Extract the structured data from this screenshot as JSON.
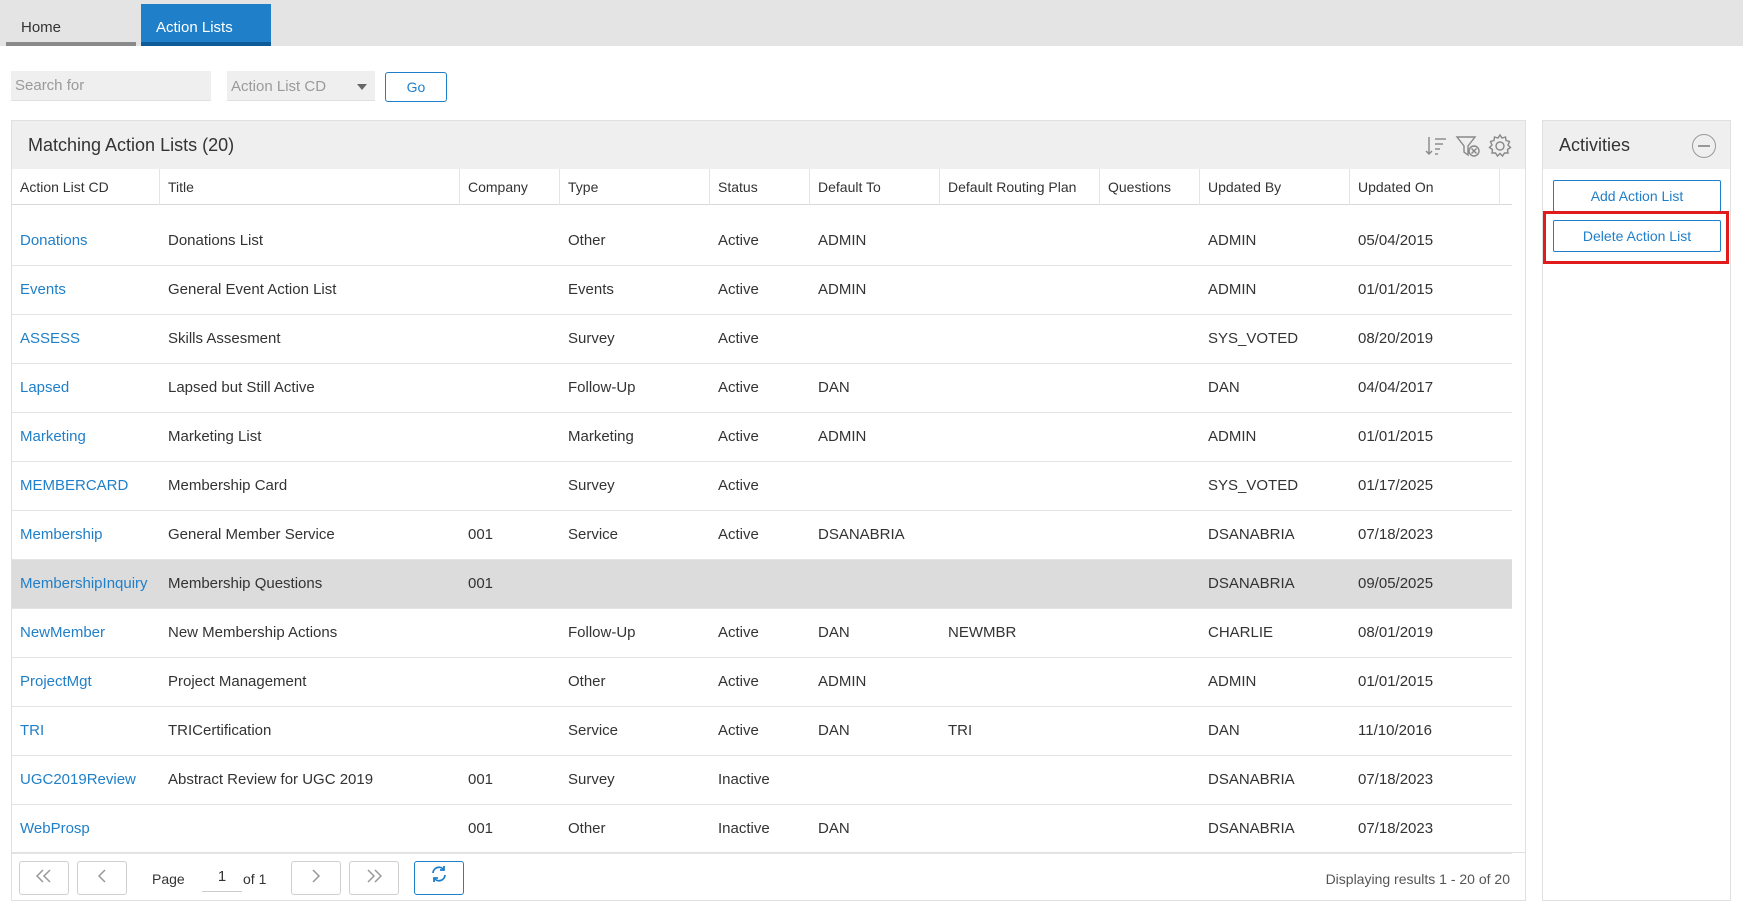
{
  "tabs": [
    {
      "label": "Home"
    },
    {
      "label": "Action Lists"
    }
  ],
  "search": {
    "placeholder": "Search for",
    "field_select": "Action List CD",
    "go_label": "Go"
  },
  "panel": {
    "title": "Matching Action Lists (20)"
  },
  "columns": [
    "Action List CD",
    "Title",
    "Company",
    "Type",
    "Status",
    "Default To",
    "Default Routing Plan",
    "Questions",
    "Updated By",
    "Updated On"
  ],
  "rows": [
    {
      "cd": "Donations",
      "title": "Donations List",
      "company": "",
      "type": "Other",
      "status": "Active",
      "default_to": "ADMIN",
      "routing": "",
      "questions": "",
      "updated_by": "ADMIN",
      "updated_on": "05/04/2015"
    },
    {
      "cd": "Events",
      "title": "General Event Action List",
      "company": "",
      "type": "Events",
      "status": "Active",
      "default_to": "ADMIN",
      "routing": "",
      "questions": "",
      "updated_by": "ADMIN",
      "updated_on": "01/01/2015"
    },
    {
      "cd": "ASSESS",
      "title": "Skills Assesment",
      "company": "",
      "type": "Survey",
      "status": "Active",
      "default_to": "",
      "routing": "",
      "questions": "",
      "updated_by": "SYS_VOTED",
      "updated_on": "08/20/2019"
    },
    {
      "cd": "Lapsed",
      "title": "Lapsed but Still Active",
      "company": "",
      "type": "Follow-Up",
      "status": "Active",
      "default_to": "DAN",
      "routing": "",
      "questions": "",
      "updated_by": "DAN",
      "updated_on": "04/04/2017"
    },
    {
      "cd": "Marketing",
      "title": "Marketing List",
      "company": "",
      "type": "Marketing",
      "status": "Active",
      "default_to": "ADMIN",
      "routing": "",
      "questions": "",
      "updated_by": "ADMIN",
      "updated_on": "01/01/2015"
    },
    {
      "cd": "MEMBERCARD",
      "title": "Membership Card",
      "company": "",
      "type": "Survey",
      "status": "Active",
      "default_to": "",
      "routing": "",
      "questions": "",
      "updated_by": "SYS_VOTED",
      "updated_on": "01/17/2025"
    },
    {
      "cd": "Membership",
      "title": "General Member Service",
      "company": "001",
      "type": "Service",
      "status": "Active",
      "default_to": "DSANABRIA",
      "routing": "",
      "questions": "",
      "updated_by": "DSANABRIA",
      "updated_on": "07/18/2023"
    },
    {
      "cd": "MembershipInquiry",
      "title": "Membership Questions",
      "company": "001",
      "type": "",
      "status": "",
      "default_to": "",
      "routing": "",
      "questions": "",
      "updated_by": "DSANABRIA",
      "updated_on": "09/05/2025",
      "selected": true
    },
    {
      "cd": "NewMember",
      "title": "New Membership Actions",
      "company": "",
      "type": "Follow-Up",
      "status": "Active",
      "default_to": "DAN",
      "routing": "NEWMBR",
      "questions": "",
      "updated_by": "CHARLIE",
      "updated_on": "08/01/2019"
    },
    {
      "cd": "ProjectMgt",
      "title": "Project Management",
      "company": "",
      "type": "Other",
      "status": "Active",
      "default_to": "ADMIN",
      "routing": "",
      "questions": "",
      "updated_by": "ADMIN",
      "updated_on": "01/01/2015"
    },
    {
      "cd": "TRI",
      "title": "TRICertification",
      "company": "",
      "type": "Service",
      "status": "Active",
      "default_to": "DAN",
      "routing": "TRI",
      "questions": "",
      "updated_by": "DAN",
      "updated_on": "11/10/2016"
    },
    {
      "cd": "UGC2019Review",
      "title": "Abstract Review for UGC 2019",
      "company": "001",
      "type": "Survey",
      "status": "Inactive",
      "default_to": "",
      "routing": "",
      "questions": "",
      "updated_by": "DSANABRIA",
      "updated_on": "07/18/2023"
    },
    {
      "cd": "WebProsp",
      "title": "",
      "company": "001",
      "type": "Other",
      "status": "Inactive",
      "default_to": "DAN",
      "routing": "",
      "questions": "",
      "updated_by": "DSANABRIA",
      "updated_on": "07/18/2023"
    }
  ],
  "pager": {
    "page_label": "Page",
    "page_value": "1",
    "of_label": "of 1",
    "status": "Displaying results 1 - 20 of 20"
  },
  "activities": {
    "title": "Activities",
    "buttons": [
      "Add Action List",
      "Delete Action List"
    ]
  },
  "colors": {
    "accent": "#1f7fc9",
    "highlight": "#e01b1b",
    "selected_row": "#dcdcdc"
  }
}
